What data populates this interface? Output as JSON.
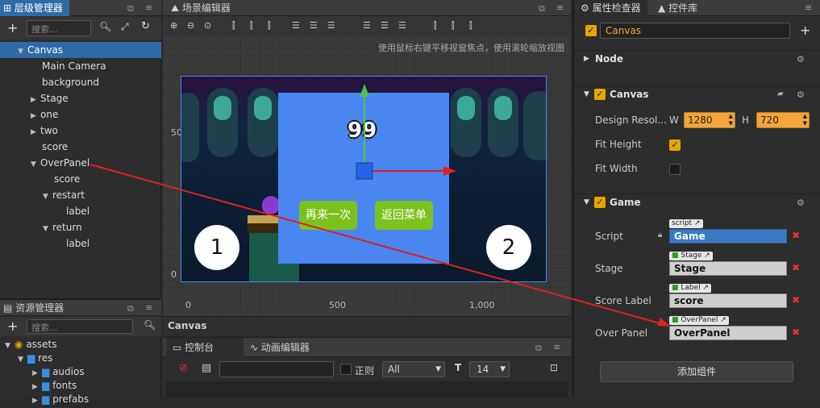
{
  "hierarchy": {
    "title": "层级管理器",
    "search_placeholder": "搜索...",
    "items": [
      {
        "label": "Canvas"
      },
      {
        "label": "Main Camera"
      },
      {
        "label": "background"
      },
      {
        "label": "Stage"
      },
      {
        "label": "one"
      },
      {
        "label": "two"
      },
      {
        "label": "score"
      },
      {
        "label": "OverPanel"
      },
      {
        "label": "score"
      },
      {
        "label": "restart"
      },
      {
        "label": "label"
      },
      {
        "label": "return"
      },
      {
        "label": "label"
      }
    ]
  },
  "assets": {
    "title": "资源管理器",
    "search_placeholder": "搜索...",
    "items": [
      {
        "label": "assets"
      },
      {
        "label": "res"
      },
      {
        "label": "audios"
      },
      {
        "label": "fonts"
      },
      {
        "label": "prefabs"
      }
    ]
  },
  "scene": {
    "title": "场景编辑器",
    "hint": "使用鼠标右键平移视窗焦点，使用滚轮缩放视图",
    "y_labels": [
      "500",
      "0"
    ],
    "x_labels": [
      "0",
      "500",
      "1,000"
    ],
    "score_text": "99",
    "btn_restart": "再来一次",
    "btn_return": "返回菜单",
    "circle_one": "1",
    "circle_two": "2",
    "footer": "Canvas"
  },
  "console": {
    "tab1": "控制台",
    "tab2": "动画编辑器",
    "regex_label": "正则",
    "filter_value": "All",
    "font_size": "14"
  },
  "inspector": {
    "tab1": "属性检查器",
    "tab2": "控件库",
    "node_name": "Canvas",
    "node_section": "Node",
    "canvas_section": "Canvas",
    "design_label": "Design Resol...",
    "w_label": "W",
    "w_value": "1280",
    "h_label": "H",
    "h_value": "720",
    "fit_height": "Fit Height",
    "fit_width": "Fit Width",
    "game_section": "Game",
    "script_label": "Script",
    "script_tag": "script",
    "script_value": "Game",
    "stage_label": "Stage",
    "stage_tag": "Stage",
    "stage_value": "Stage",
    "score_label": "Score Label",
    "score_tag": "Label",
    "score_value": "score",
    "over_label": "Over Panel",
    "over_tag": "OverPanel",
    "over_value": "OverPanel",
    "add_component": "添加组件"
  },
  "colors": {
    "selection": "#2e6aa6",
    "accent_orange": "#f2a53a",
    "panel_blue": "#4a86f0",
    "button_green": "#7cc21e",
    "arrow_red": "#e02020"
  }
}
